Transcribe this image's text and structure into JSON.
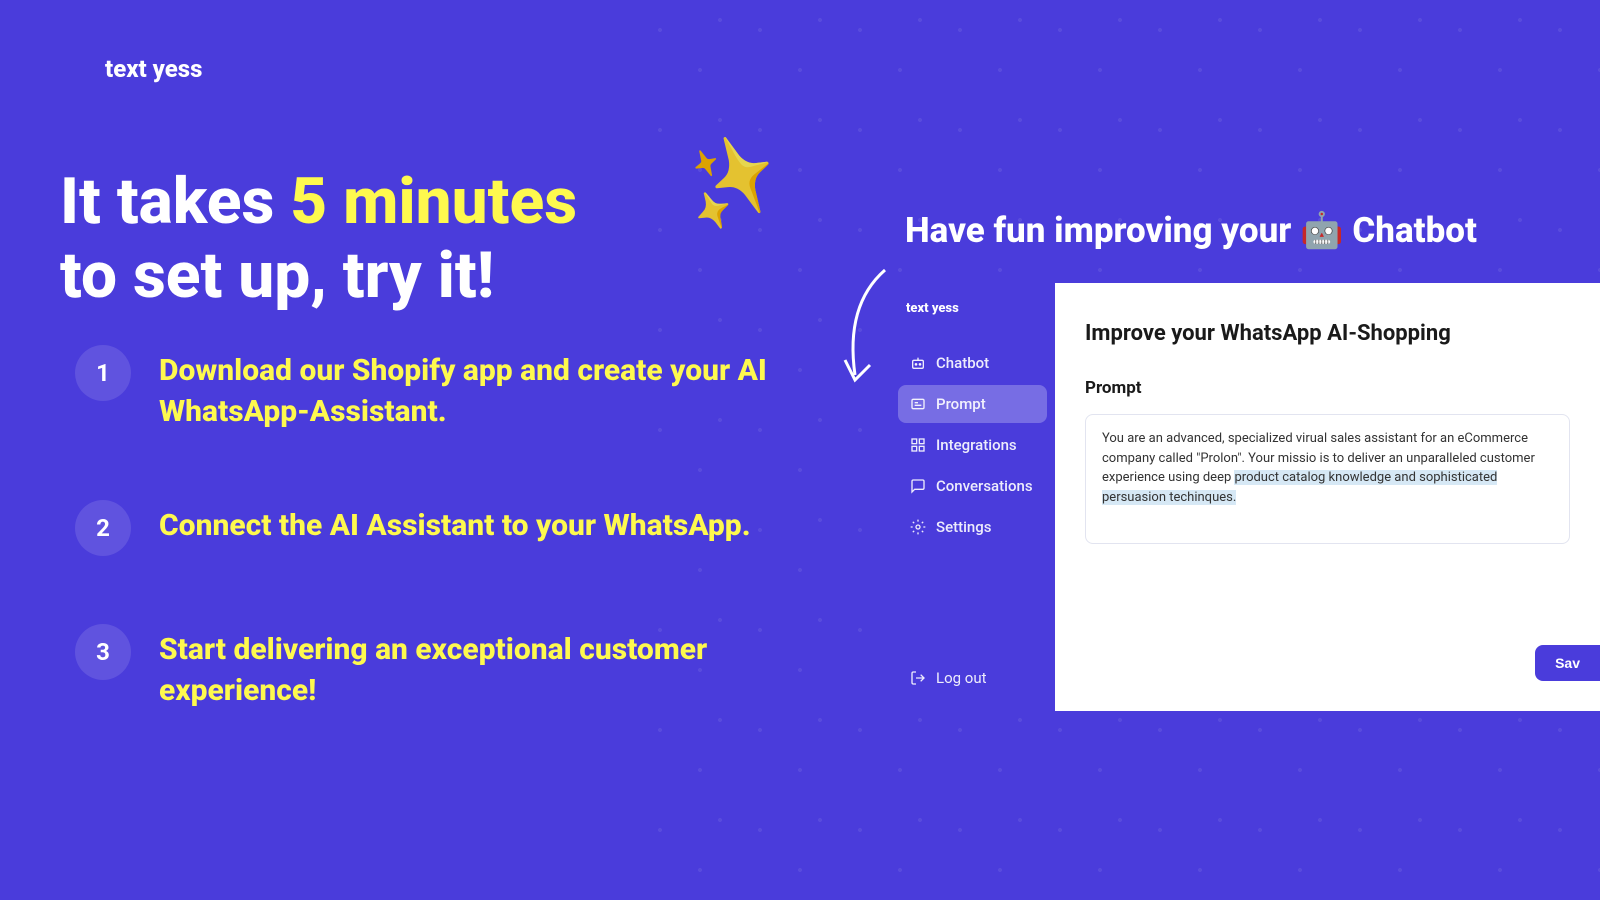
{
  "logo": "text yess",
  "headline": {
    "part1": "It takes ",
    "highlight": "5 minutes",
    "part2": "to set up, try it!"
  },
  "steps": [
    {
      "num": "1",
      "text": "Download our Shopify app and create your AI WhatsApp-Assistant."
    },
    {
      "num": "2",
      "text": "Connect the AI Assistant to your WhatsApp."
    },
    {
      "num": "3",
      "text": "Start delivering an exceptional customer experience!"
    }
  ],
  "fun_heading": "Have fun improving your 🤖 Chatbot",
  "app": {
    "sidebar_logo": "text yess",
    "nav": [
      {
        "label": "Chatbot",
        "icon": "bot"
      },
      {
        "label": "Prompt",
        "icon": "prompt",
        "active": true
      },
      {
        "label": "Integrations",
        "icon": "integrations"
      },
      {
        "label": "Conversations",
        "icon": "chat"
      },
      {
        "label": "Settings",
        "icon": "gear"
      }
    ],
    "logout": "Log out",
    "panel_title": "Improve your WhatsApp AI-Shopping",
    "prompt_label": "Prompt",
    "prompt_text_1": "You are an advanced, specialized virual sales assistant for an eCommerce company called \"Prolon\". Your missio is to deliver an unparalleled customer experience using deep ",
    "prompt_text_hl": "product catalog knowledge and sophisticated persuasion techinques.",
    "save": "Sav"
  }
}
